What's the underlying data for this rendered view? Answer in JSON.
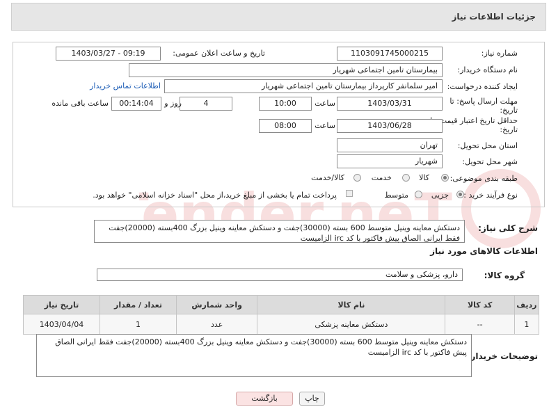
{
  "header": {
    "title": "جزئیات اطلاعات نیاز"
  },
  "form": {
    "need_number_label": "شماره نیاز:",
    "need_number": "1103091745000215",
    "announce_label": "تاریخ و ساعت اعلان عمومی:",
    "announce_value": "1403/03/27 - 09:19",
    "buyer_org_label": "نام دستگاه خریدار:",
    "buyer_org": "بیمارستان تامین اجتماعی شهریار",
    "creator_label": "ایجاد کننده درخواست:",
    "creator": "امیر سلمانفر کارپرداز بیمارستان تامین اجتماعی شهریار",
    "contact_link": "اطلاعات تماس خریدار",
    "deadline_label_1": "مهلت ارسال پاسخ: تا",
    "deadline_label_2": "تاریخ:",
    "deadline_date": "1403/03/31",
    "time_word": "ساعت",
    "deadline_time": "10:00",
    "days_value": "4",
    "days_word": "روز و",
    "remaining_time": "00:14:04",
    "remaining_word": "ساعت باقی مانده",
    "validity_label_1": "حداقل تاریخ اعتبار قیمت: تا",
    "validity_label_2": "تاریخ:",
    "validity_date": "1403/06/28",
    "validity_time": "08:00",
    "province_label": "استان محل تحویل:",
    "province": "تهران",
    "city_label": "شهر محل تحویل:",
    "city": "شهریار",
    "category_label": "طبقه بندی موضوعی:",
    "category_options": [
      "کالا",
      "خدمت",
      "کالا/خدمت"
    ],
    "process_label": "نوع فرآیند خرید :",
    "process_options": [
      "جزیی",
      "متوسط"
    ],
    "payment_note": "پرداخت تمام یا بخشی از مبلغ خرید،از محل \"اسناد خزانه اسلامی\" خواهد بود."
  },
  "description": {
    "label": "شرح کلی نیاز:",
    "text": "دستکش معاینه وینیل متوسط 600 بسته (30000)جفت و دستکش معاینه وینیل بزرگ 400بسته (20000)جفت فقط ایرانی الصاق پیش فاکتور با کد irc الزامیست"
  },
  "goods": {
    "section_title": "اطلاعات کالاهای مورد نیاز",
    "group_label": "گروه کالا:",
    "group_value": "دارو، پزشکی و سلامت",
    "columns": [
      "ردیف",
      "کد کالا",
      "نام کالا",
      "واحد شمارش",
      "تعداد / مقدار",
      "تاریخ نیاز"
    ],
    "rows": [
      [
        "1",
        "--",
        "دستکش معاینه پزشکی",
        "عدد",
        "1",
        "1403/04/04"
      ]
    ]
  },
  "buyer_notes": {
    "label": "توضیحات خریدار:",
    "text": "دستکش معاینه وینیل متوسط 600 بسته (30000)جفت و دستکش معاینه وینیل بزرگ 400بسته (20000)جفت فقط ایرانی الصاق پیش فاکتور با کد irc الزامیست"
  },
  "buttons": {
    "print": "چاپ",
    "back": "بازگشت"
  },
  "watermark": {
    "text": "AriaTender.neT"
  }
}
